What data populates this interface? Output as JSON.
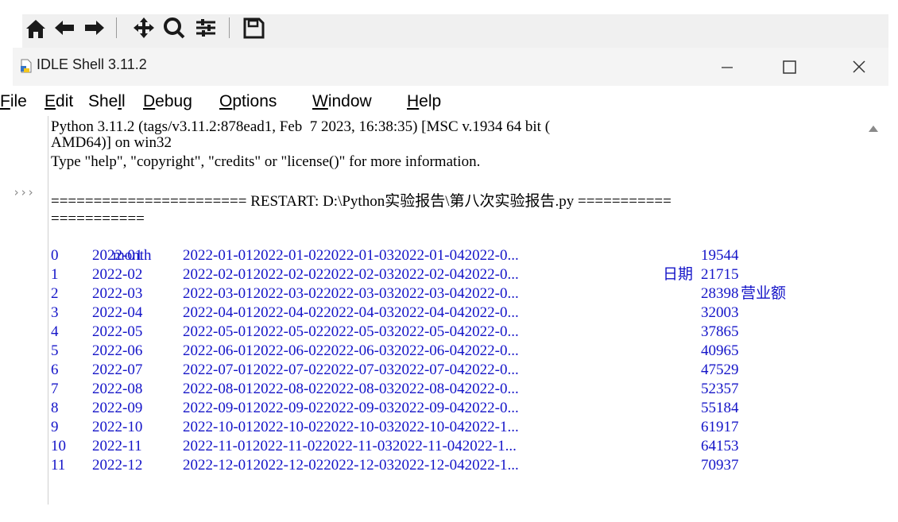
{
  "window": {
    "title": "IDLE Shell 3.11.2"
  },
  "menu": [
    "File",
    "Edit",
    "Shell",
    "Debug",
    "Options",
    "Window",
    "Help"
  ],
  "menu_mnemonic": [
    "F",
    "E",
    "l",
    "D",
    "O",
    "W",
    "H"
  ],
  "shell": {
    "prompt": "›››",
    "banner_line1": "Python 3.11.2 (tags/v3.11.2:878ead1, Feb  7 2023, 16:38:35) [MSC v.1934 64 bit (",
    "banner_line2": "AMD64)] on win32",
    "banner_line3": "Type \"help\", \"copyright\", \"credits\" or \"license()\" for more information.",
    "restart_line1": "======================= RESTART: D:\\Python实验报告\\第八次实验报告.py ===========",
    "restart_line2": "===========",
    "header_month": "month",
    "header_date": "日期",
    "header_sales": "营业额",
    "rows": [
      {
        "idx": "0",
        "month": "2022-01",
        "dates": "2022-01-012022-01-022022-01-032022-01-042022-0...",
        "sales": "19544"
      },
      {
        "idx": "1",
        "month": "2022-02",
        "dates": "2022-02-012022-02-022022-02-032022-02-042022-0...",
        "sales": "21715"
      },
      {
        "idx": "2",
        "month": "2022-03",
        "dates": "2022-03-012022-03-022022-03-032022-03-042022-0...",
        "sales": "28398"
      },
      {
        "idx": "3",
        "month": "2022-04",
        "dates": "2022-04-012022-04-022022-04-032022-04-042022-0...",
        "sales": "32003"
      },
      {
        "idx": "4",
        "month": "2022-05",
        "dates": "2022-05-012022-05-022022-05-032022-05-042022-0...",
        "sales": "37865"
      },
      {
        "idx": "5",
        "month": "2022-06",
        "dates": "2022-06-012022-06-022022-06-032022-06-042022-0...",
        "sales": "40965"
      },
      {
        "idx": "6",
        "month": "2022-07",
        "dates": "2022-07-012022-07-022022-07-032022-07-042022-0...",
        "sales": "47529"
      },
      {
        "idx": "7",
        "month": "2022-08",
        "dates": "2022-08-012022-08-022022-08-032022-08-042022-0...",
        "sales": "52357"
      },
      {
        "idx": "8",
        "month": "2022-09",
        "dates": "2022-09-012022-09-022022-09-032022-09-042022-0...",
        "sales": "55184"
      },
      {
        "idx": "9",
        "month": "2022-10",
        "dates": "2022-10-012022-10-022022-10-032022-10-042022-1...",
        "sales": "61917"
      },
      {
        "idx": "10",
        "month": "2022-11",
        "dates": "2022-11-012022-11-022022-11-032022-11-042022-1...",
        "sales": "64153"
      },
      {
        "idx": "11",
        "month": "2022-12",
        "dates": "2022-12-012022-12-022022-12-032022-12-042022-1...",
        "sales": "70937"
      }
    ]
  },
  "toolbar_icons": [
    "home-icon",
    "back-arrow-icon",
    "forward-arrow-icon",
    "pan-icon",
    "zoom-icon",
    "configure-subplots-icon",
    "save-icon"
  ],
  "colors": {
    "output_blue": "#1414c8",
    "titlebar": "#f4f4f4",
    "toolbar": "#f0f0f0"
  }
}
